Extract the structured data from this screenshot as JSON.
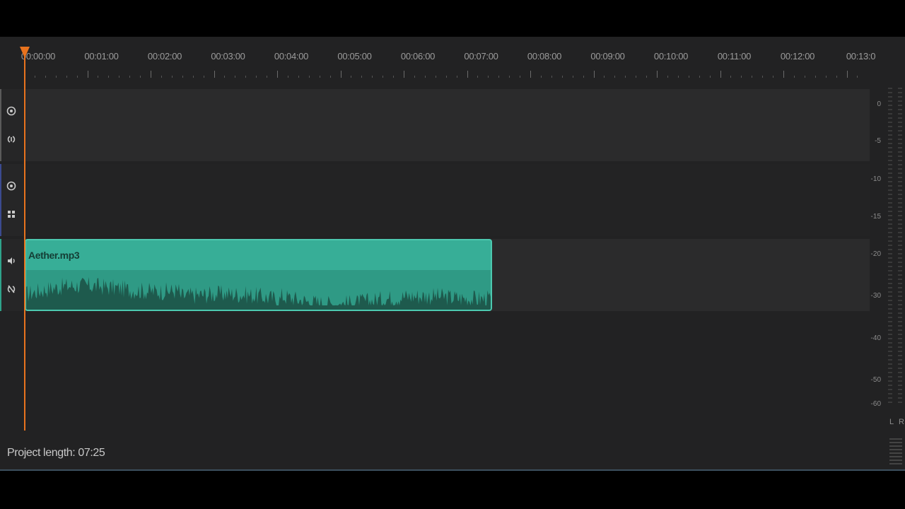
{
  "timeline": {
    "ticks": [
      "00:00:00",
      "00:01:00",
      "00:02:00",
      "00:03:00",
      "00:04:00",
      "00:05:00",
      "00:06:00",
      "00:07:00",
      "00:08:00",
      "00:09:00",
      "00:10:00",
      "00:11:00",
      "00:12:00",
      "00:13:0"
    ],
    "playhead_time": "00:00:00"
  },
  "tracks": [
    {
      "kind": "video",
      "accent": "#5a5a5a",
      "icons": [
        "visibility-icon",
        "link-icon"
      ]
    },
    {
      "kind": "effects",
      "accent": "#3b4a8f",
      "icons": [
        "visibility-icon",
        "effects-icon"
      ]
    },
    {
      "kind": "audio",
      "accent": "#2fa38b",
      "icons": [
        "speaker-icon",
        "unlink-icon"
      ]
    }
  ],
  "clip": {
    "name": "Aether.mp3",
    "start_time": "00:00:00",
    "end_time": "07:25",
    "fill_color": "#37ae97",
    "wave_color": "#1e5a4d"
  },
  "meter": {
    "db_labels": [
      "0",
      "-5",
      "-10",
      "-15",
      "-20",
      "-30",
      "-40",
      "-50",
      "-60"
    ],
    "left_label": "L",
    "right_label": "R"
  },
  "status": {
    "project_length": "Project length: 07:25"
  },
  "colors": {
    "playhead": "#e8731e",
    "background": "#222223"
  }
}
